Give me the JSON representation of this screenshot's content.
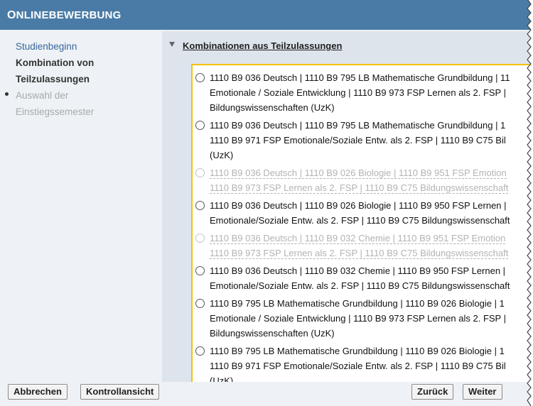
{
  "header": {
    "title_first": "O",
    "title_rest": "NLINEBEWERBUNG"
  },
  "sidebar": {
    "steps": [
      {
        "label": "Studienbeginn",
        "state": "link"
      },
      {
        "label_line1": "Kombination von",
        "label_line2": "Teilzulassungen",
        "state": "current"
      },
      {
        "label_line1": "Auswahl der",
        "label_line2": "Einstiegssemester",
        "state": "disabled"
      }
    ]
  },
  "section": {
    "title": "Kombinationen aus Teilzulassungen"
  },
  "options": [
    {
      "enabled": true,
      "lines": [
        "1110 B9 036 Deutsch | 1110 B9 795 LB Mathematische Grundbildung | 11",
        "Emotionale / Soziale Entwicklung | 1110 B9 973 FSP Lernen als 2. FSP |",
        "Bildungswissenschaften (UzK)"
      ]
    },
    {
      "enabled": true,
      "lines": [
        "1110 B9 036 Deutsch | 1110 B9 795 LB Mathematische Grundbildung | 1",
        "1110 B9 971 FSP Emotionale/Soziale Entw. als 2. FSP | 1110 B9 C75 Bil",
        "(UzK)"
      ]
    },
    {
      "enabled": false,
      "lines": [
        "1110 B9 036 Deutsch | 1110 B9 026 Biologie | 1110 B9 951 FSP Emotion",
        "1110 B9 973 FSP Lernen als 2. FSP | 1110 B9 C75 Bildungswissenschaft"
      ]
    },
    {
      "enabled": true,
      "lines": [
        "1110 B9 036 Deutsch | 1110 B9 026 Biologie | 1110 B9 950 FSP Lernen |",
        "Emotionale/Soziale Entw. als 2. FSP | 1110 B9 C75 Bildungswissenschaft"
      ]
    },
    {
      "enabled": false,
      "lines": [
        "1110 B9 036 Deutsch | 1110 B9 032 Chemie | 1110 B9 951 FSP Emotion",
        "1110 B9 973 FSP Lernen als 2. FSP | 1110 B9 C75 Bildungswissenschaft"
      ]
    },
    {
      "enabled": true,
      "lines": [
        "1110 B9 036 Deutsch | 1110 B9 032 Chemie | 1110 B9 950 FSP Lernen |",
        "Emotionale/Soziale Entw. als 2. FSP | 1110 B9 C75 Bildungswissenschaft"
      ]
    },
    {
      "enabled": true,
      "lines": [
        "1110 B9 795 LB Mathematische Grundbildung | 1110 B9 026 Biologie | 1",
        "Emotionale / Soziale Entwicklung | 1110 B9 973 FSP Lernen als 2. FSP |",
        "Bildungswissenschaften (UzK)"
      ]
    },
    {
      "enabled": true,
      "lines": [
        "1110 B9 795 LB Mathematische Grundbildung | 1110 B9 026 Biologie | 1",
        "1110 B9 971 FSP Emotionale/Soziale Entw. als 2. FSP | 1110 B9 C75 Bil",
        "(UzK)"
      ]
    }
  ],
  "footer": {
    "cancel_label": "Abbrechen",
    "review_label": "Kontrollansicht",
    "back_label": "Zurück",
    "next_label": "Weiter"
  },
  "colors": {
    "header_bg": "#4a7ba6",
    "panel_border": "#f2c200",
    "link": "#35679a"
  }
}
